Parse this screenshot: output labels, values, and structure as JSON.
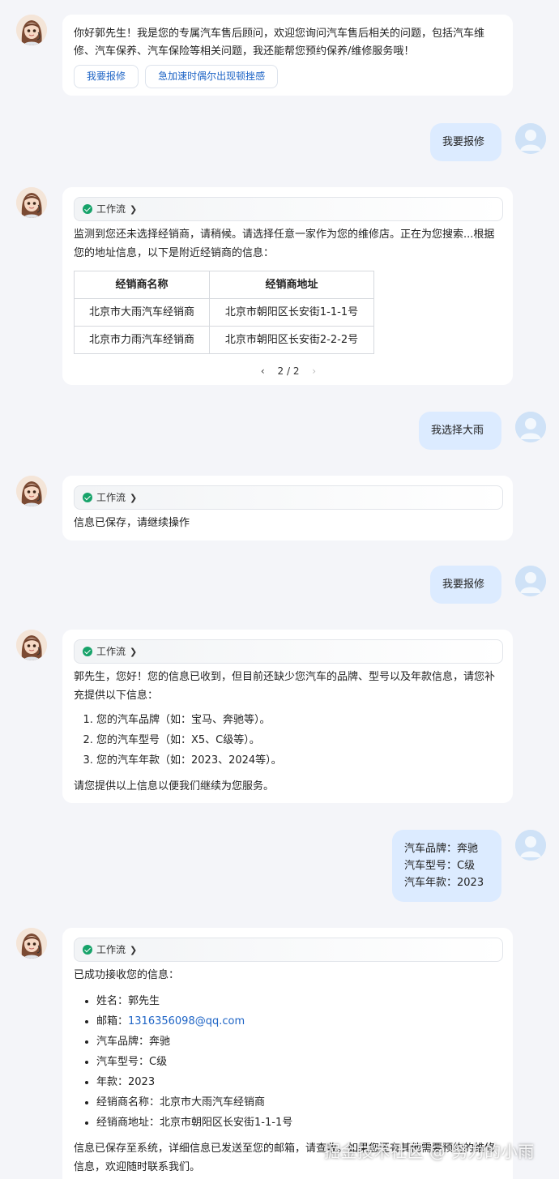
{
  "colors": {
    "background": "#f4f5f9",
    "bubble": "#dcebff",
    "link": "#1f65c6",
    "check": "#17a36a"
  },
  "workflow_label": "工作流",
  "welcome": {
    "text": "你好郭先生！我是您的专属汽车售后顾问，欢迎您询问汽车售后相关的问题，包括汽车维修、汽车保养、汽车保险等相关问题，我还能帮您预约保养/维修服务哦！",
    "chips": [
      "我要报修",
      "急加速时偶尔出现顿挫感"
    ]
  },
  "user1": "我要报修",
  "reply1": {
    "text": "监测到您还未选择经销商，请稍候。请选择任意一家作为您的维修店。正在为您搜索...根据您的地址信息，以下是附近经销商的信息：",
    "table": {
      "headers": [
        "经销商名称",
        "经销商地址"
      ],
      "rows": [
        [
          "北京市大雨汽车经销商",
          "北京市朝阳区长安街1-1-1号"
        ],
        [
          "北京市力雨汽车经销商",
          "北京市朝阳区长安街2-2-2号"
        ]
      ]
    },
    "pager": "2 / 2"
  },
  "user2": "我选择大雨",
  "reply2": {
    "text": "信息已保存，请继续操作"
  },
  "user3": "我要报修",
  "reply3": {
    "intro": "郭先生，您好！您的信息已收到，但目前还缺少您汽车的品牌、型号以及年款信息，请您补充提供以下信息：",
    "items": [
      "您的汽车品牌（如：宝马、奔驰等）。",
      "您的汽车型号（如：X5、C级等）。",
      "您的汽车年款（如：2023、2024等）。"
    ],
    "outro": "请您提供以上信息以便我们继续为您服务。"
  },
  "user4": {
    "lines": [
      "汽车品牌：奔驰",
      "汽车型号：C级",
      "汽车年款：2023"
    ]
  },
  "reply4": {
    "intro": "已成功接收您的信息：",
    "items": [
      {
        "label": "姓名：",
        "value": "郭先生"
      },
      {
        "label": "邮箱：",
        "value": "1316356098@qq.com"
      },
      {
        "label": "汽车品牌：",
        "value": "奔驰"
      },
      {
        "label": "汽车型号：",
        "value": "C级"
      },
      {
        "label": "年款：",
        "value": "2023"
      },
      {
        "label": "经销商名称：",
        "value": "北京市大雨汽车经销商"
      },
      {
        "label": "经销商地址：",
        "value": "北京市朝阳区长安街1-1-1号"
      }
    ],
    "outro": "信息已保存至系统，详细信息已发送至您的邮箱，请查收。如果您还有其他需要预约的维修信息，欢迎随时联系我们。"
  },
  "watermark": "掘金技术社区 @ 努力的小雨"
}
